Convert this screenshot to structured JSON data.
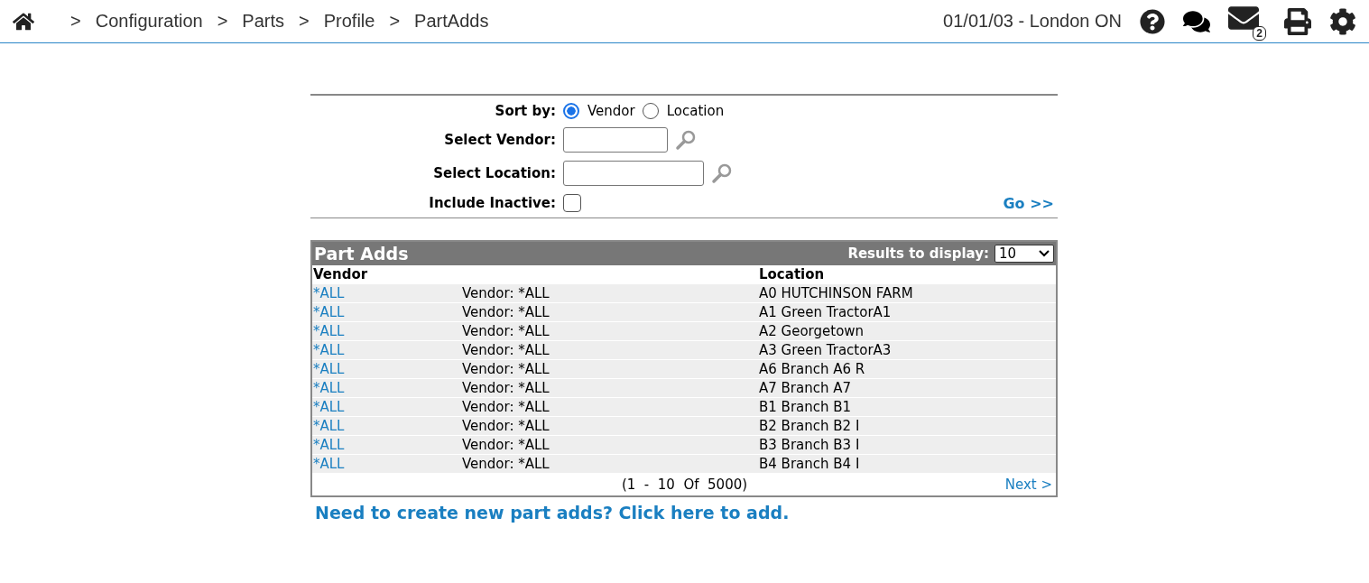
{
  "header": {
    "separator": ">",
    "breadcrumbs": [
      "Configuration",
      "Parts",
      "Profile",
      "PartAdds"
    ],
    "context": "01/01/03 - London ON",
    "mail_count": "2"
  },
  "filters": {
    "sort_label": "Sort by:",
    "sort_options": [
      {
        "label": "Vendor",
        "selected": true
      },
      {
        "label": "Location",
        "selected": false
      }
    ],
    "vendor_label": "Select Vendor:",
    "location_label": "Select Location:",
    "inactive_label": "Include Inactive:",
    "include_inactive": false,
    "go": "Go >>"
  },
  "table": {
    "title": "Part Adds",
    "results_label": "Results to display:",
    "results_value": "10",
    "columns": [
      "Vendor",
      "",
      "Location"
    ],
    "rows": [
      {
        "vendor": "*ALL",
        "description": "Vendor: *ALL",
        "location": "A0 HUTCHINSON FARM"
      },
      {
        "vendor": "*ALL",
        "description": "Vendor: *ALL",
        "location": "A1 Green TractorA1"
      },
      {
        "vendor": "*ALL",
        "description": "Vendor: *ALL",
        "location": "A2 Georgetown"
      },
      {
        "vendor": "*ALL",
        "description": "Vendor: *ALL",
        "location": "A3 Green TractorA3"
      },
      {
        "vendor": "*ALL",
        "description": "Vendor: *ALL",
        "location": "A6 Branch A6 R"
      },
      {
        "vendor": "*ALL",
        "description": "Vendor: *ALL",
        "location": "A7 Branch A7"
      },
      {
        "vendor": "*ALL",
        "description": "Vendor: *ALL",
        "location": "B1 Branch B1"
      },
      {
        "vendor": "*ALL",
        "description": "Vendor: *ALL",
        "location": "B2 Branch B2 I"
      },
      {
        "vendor": "*ALL",
        "description": "Vendor: *ALL",
        "location": "B3 Branch B3 I"
      },
      {
        "vendor": "*ALL",
        "description": "Vendor: *ALL",
        "location": "B4 Branch B4 I"
      }
    ],
    "pagination": "(1  -  10  Of  5000)",
    "next": "Next >"
  },
  "create_link": "Need to create new part adds? Click here to add."
}
